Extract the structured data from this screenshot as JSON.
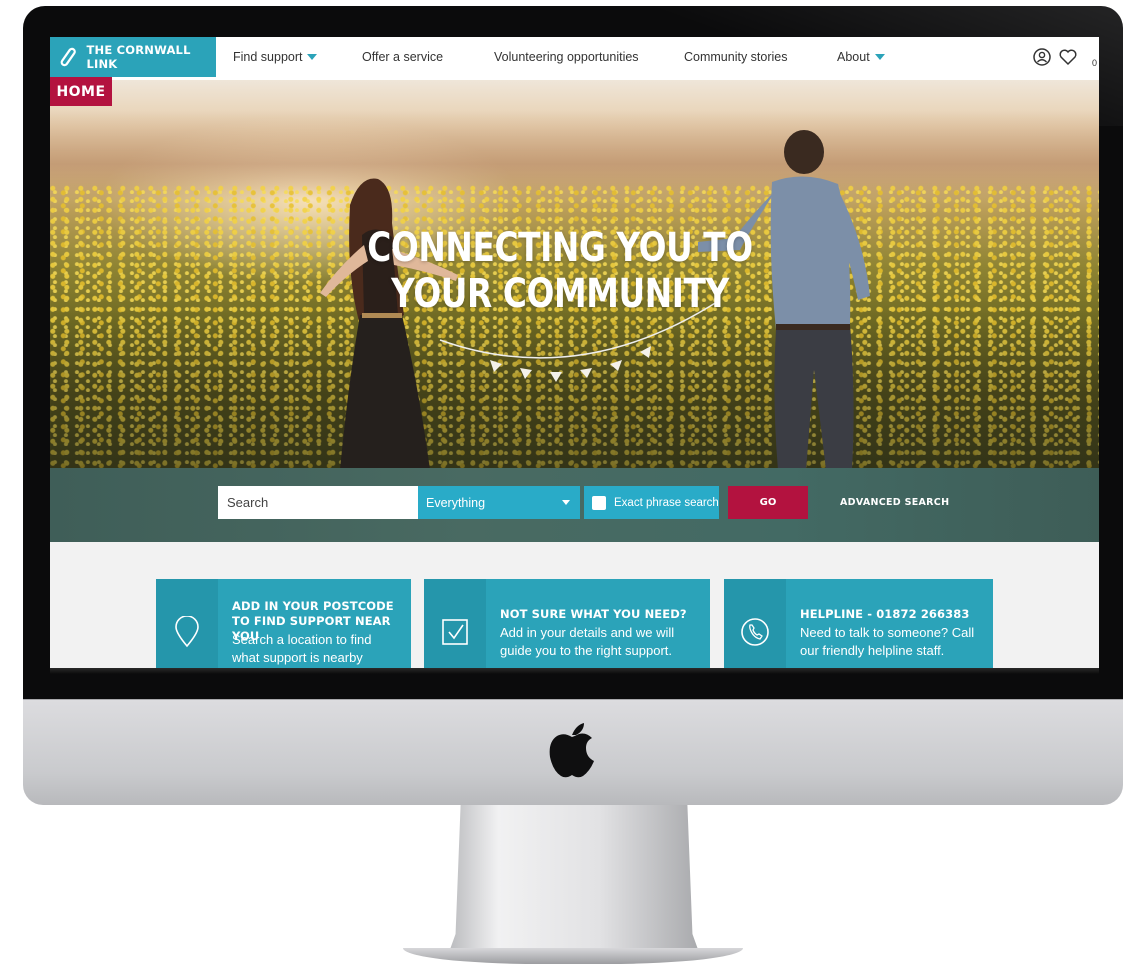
{
  "brand": {
    "name": "THE CORNWALL LINK",
    "page_tag": "HOME"
  },
  "nav": {
    "items": [
      {
        "label": "Find support",
        "has_dropdown": true
      },
      {
        "label": "Offer a service",
        "has_dropdown": false
      },
      {
        "label": "Volunteering opportunities",
        "has_dropdown": false
      },
      {
        "label": "Community stories",
        "has_dropdown": false
      },
      {
        "label": "About",
        "has_dropdown": true
      }
    ],
    "icons": [
      "account-icon",
      "favourites-icon"
    ],
    "favourites_count": "0"
  },
  "hero": {
    "title": "CONNECTING YOU TO YOUR COMMUNITY"
  },
  "search": {
    "placeholder": "Search",
    "scope_value": "Everything",
    "exact_phrase_label": "Exact phrase search",
    "exact_phrase_checked": false,
    "go_label": "GO",
    "advanced_label": "ADVANCED SEARCH"
  },
  "cards": [
    {
      "icon": "location-pin-icon",
      "title": "ADD IN YOUR POSTCODE TO FIND SUPPORT NEAR YOU",
      "body": "Search a location to find what support is nearby"
    },
    {
      "icon": "checkbox-tick-icon",
      "title": "NOT SURE WHAT YOU NEED?",
      "body": "Add in your details and we will guide you to the right support."
    },
    {
      "icon": "phone-icon",
      "title": "HELPLINE - 01872 266383",
      "body": "Need to talk to someone? Call our friendly helpline staff."
    }
  ],
  "colors": {
    "brand_teal": "#2ba3b9",
    "accent_red": "#b3123f",
    "search_band": "#466760"
  },
  "device": {
    "logo": "apple-logo-icon"
  }
}
